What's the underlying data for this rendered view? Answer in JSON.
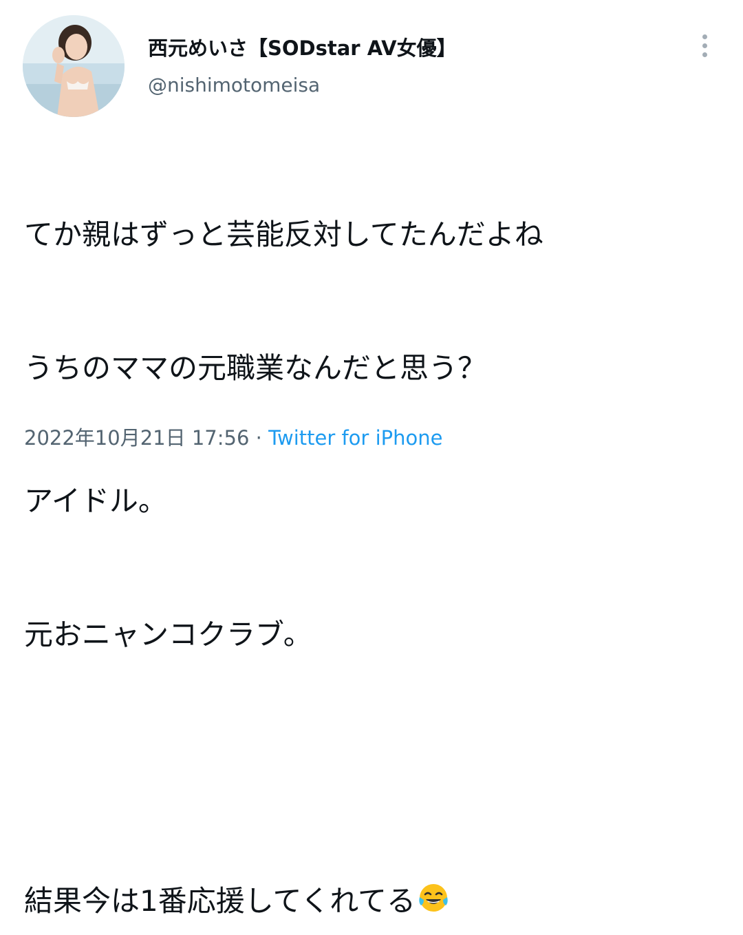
{
  "author": {
    "display_name": "西元めいさ【SODstar AV女優】",
    "handle": "@nishimotomeisa"
  },
  "tweet": {
    "lines": [
      "てか親はずっと芸能反対してたんだよね",
      "うちのママの元職業なんだと思う？",
      "アイドル。",
      "元おニャンコクラブ。",
      "",
      "結果今は1番応援してくれてる"
    ],
    "emoji": "face-with-tears-of-joy"
  },
  "meta": {
    "timestamp": "2022年10月21日 17:56",
    "separator": " · ",
    "source": "Twitter for iPhone"
  },
  "colors": {
    "text": "#0f1419",
    "secondary": "#536471",
    "link": "#1d9bf0",
    "menu_dots": "#a3adb6"
  }
}
